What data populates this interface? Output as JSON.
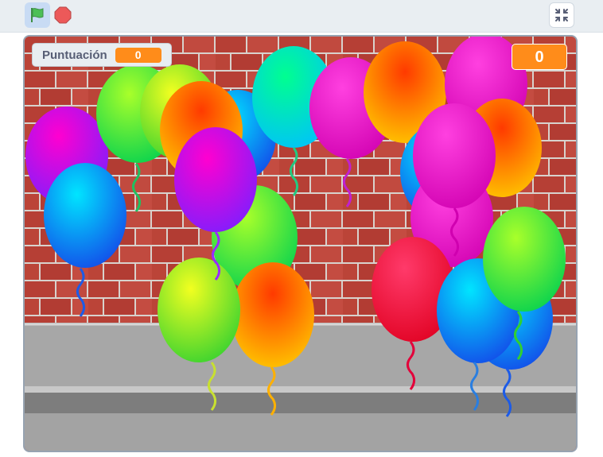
{
  "toolbar": {
    "green_flag_icon": "green-flag-icon",
    "stop_icon": "stop-icon",
    "shrink_icon": "shrink-stage-icon"
  },
  "stage": {
    "monitor": {
      "label": "Puntuación",
      "value": "0"
    },
    "score_display": "0",
    "sprites": "balloons"
  },
  "colors": {
    "accent": "#ff8c1a",
    "flag": "#4cbf56",
    "stop": "#ec5959"
  }
}
